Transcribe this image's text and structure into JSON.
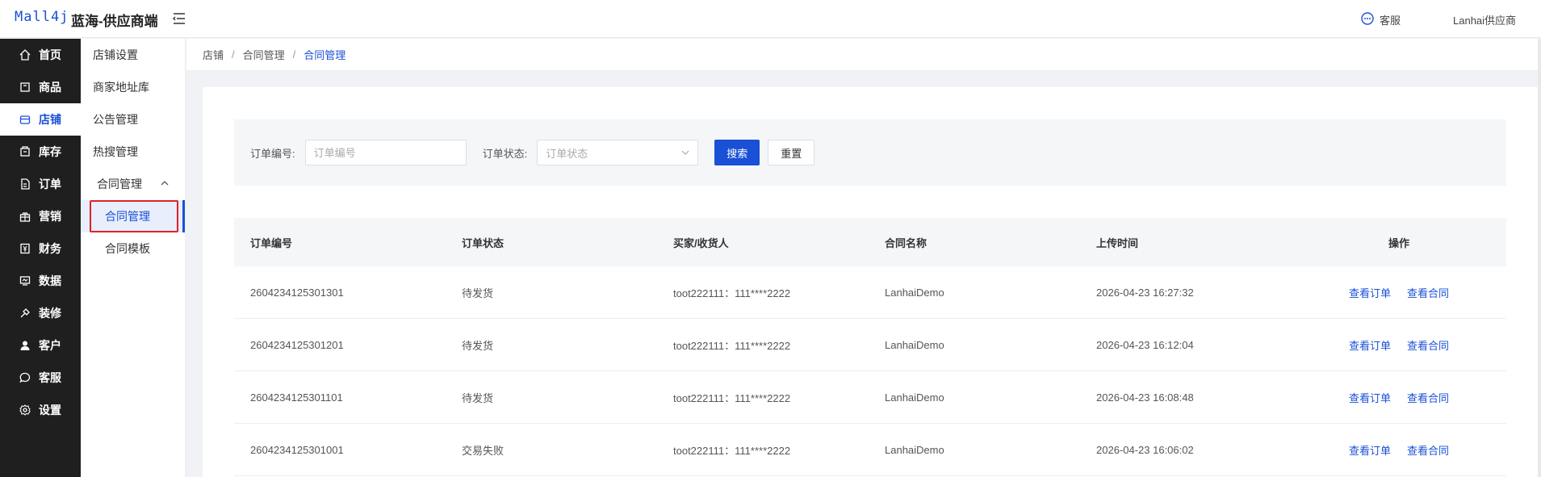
{
  "header": {
    "logo": "Mall4j",
    "shop_name": "蓝海-供应商端",
    "service_label": "客服",
    "user_label": "Lanhai供应商"
  },
  "nav": {
    "items": [
      {
        "label": "首页",
        "icon": "home-icon"
      },
      {
        "label": "商品",
        "icon": "product-icon"
      },
      {
        "label": "店铺",
        "icon": "store-icon",
        "active": true
      },
      {
        "label": "库存",
        "icon": "inventory-icon"
      },
      {
        "label": "订单",
        "icon": "order-icon"
      },
      {
        "label": "营销",
        "icon": "gift-icon"
      },
      {
        "label": "财务",
        "icon": "finance-icon"
      },
      {
        "label": "数据",
        "icon": "data-icon"
      },
      {
        "label": "装修",
        "icon": "decorate-icon"
      },
      {
        "label": "客户",
        "icon": "user-icon"
      },
      {
        "label": "客服",
        "icon": "chat-icon"
      },
      {
        "label": "设置",
        "icon": "settings-icon"
      }
    ]
  },
  "subnav": {
    "items": [
      "店铺设置",
      "商家地址库",
      "公告管理",
      "热搜管理"
    ],
    "group": "合同管理",
    "children": [
      "合同管理",
      "合同模板"
    ]
  },
  "breadcrumb": [
    "店铺",
    "合同管理",
    "合同管理"
  ],
  "search": {
    "order_no_label": "订单编号:",
    "order_no_placeholder": "订单编号",
    "status_label": "订单状态:",
    "status_placeholder": "订单状态",
    "search_btn": "搜索",
    "reset_btn": "重置"
  },
  "table": {
    "headers": [
      "订单编号",
      "订单状态",
      "买家/收货人",
      "合同名称",
      "上传时间",
      "操作"
    ],
    "action_view_order": "查看订单",
    "action_view_contract": "查看合同",
    "rows": [
      {
        "order_no": "2604234125301301",
        "status": "待发货",
        "buyer": "toot222111：111****2222",
        "contract": "LanhaiDemo",
        "time": "2026-04-23 16:27:32"
      },
      {
        "order_no": "2604234125301201",
        "status": "待发货",
        "buyer": "toot222111：111****2222",
        "contract": "LanhaiDemo",
        "time": "2026-04-23 16:12:04"
      },
      {
        "order_no": "2604234125301101",
        "status": "待发货",
        "buyer": "toot222111：111****2222",
        "contract": "LanhaiDemo",
        "time": "2026-04-23 16:08:48"
      },
      {
        "order_no": "2604234125301001",
        "status": "交易失败",
        "buyer": "toot222111：111****2222",
        "contract": "LanhaiDemo",
        "time": "2026-04-23 16:06:02"
      }
    ]
  },
  "colors": {
    "primary": "#1a50d6",
    "nav_bg": "#1f1f1f",
    "highlight": "#e0202a"
  }
}
